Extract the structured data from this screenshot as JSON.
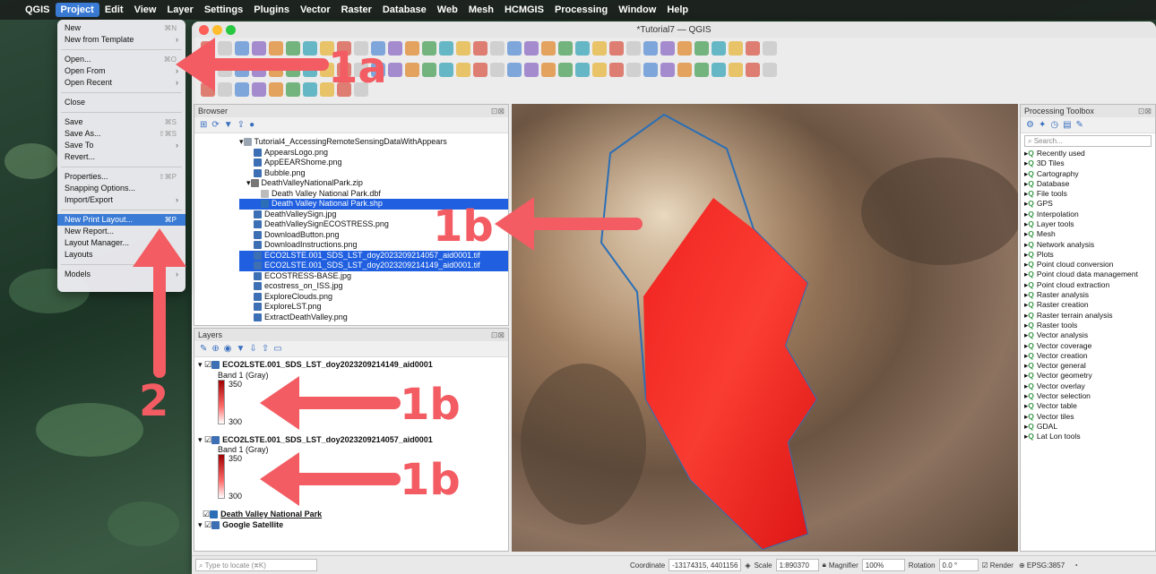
{
  "menubar": {
    "app": "QGIS",
    "items": [
      "Project",
      "Edit",
      "View",
      "Layer",
      "Settings",
      "Plugins",
      "Vector",
      "Raster",
      "Database",
      "Web",
      "Mesh",
      "HCMGIS",
      "Processing",
      "Window",
      "Help"
    ]
  },
  "window": {
    "title": "*Tutorial7 — QGIS"
  },
  "project_menu": {
    "items": [
      {
        "label": "New",
        "shortcut": "⌘N",
        "dim": false
      },
      {
        "label": "New from Template",
        "arrow": "›"
      },
      {
        "sep": true
      },
      {
        "label": "Open...",
        "shortcut": "⌘O"
      },
      {
        "label": "Open From",
        "arrow": "›"
      },
      {
        "label": "Open Recent",
        "arrow": "›"
      },
      {
        "sep": true
      },
      {
        "label": "Close"
      },
      {
        "sep": true
      },
      {
        "label": "Save",
        "shortcut": "⌘S"
      },
      {
        "label": "Save As...",
        "shortcut": "⇧⌘S"
      },
      {
        "label": "Save To",
        "arrow": "›"
      },
      {
        "label": "Revert..."
      },
      {
        "sep": true
      },
      {
        "label": "Properties...",
        "shortcut": "⇧⌘P"
      },
      {
        "label": "Snapping Options..."
      },
      {
        "label": "Import/Export",
        "arrow": "›"
      },
      {
        "sep": true
      },
      {
        "label": "New Print Layout...",
        "shortcut": "⌘P",
        "highlight": true
      },
      {
        "label": "New Report..."
      },
      {
        "label": "Layout Manager..."
      },
      {
        "label": "Layouts",
        "arrow": "›"
      },
      {
        "sep": true
      },
      {
        "label": "Models",
        "arrow": "›"
      }
    ]
  },
  "browser": {
    "title": "Browser",
    "items": [
      {
        "label": "Tutorial4_AccessingRemoteSensingDataWithAppears",
        "indent": 0,
        "icon": "folder"
      },
      {
        "label": "AppearsLogo.png",
        "indent": 2,
        "icon": "raster"
      },
      {
        "label": "AppEEARShome.png",
        "indent": 2,
        "icon": "raster"
      },
      {
        "label": "Bubble.png",
        "indent": 2,
        "icon": "raster"
      },
      {
        "label": "DeathValleyNationalPark.zip",
        "indent": 1,
        "icon": "zip"
      },
      {
        "label": "Death Valley National Park.dbf",
        "indent": 3,
        "icon": "table"
      },
      {
        "label": "Death Valley National Park.shp",
        "indent": 3,
        "icon": "vector",
        "sel": true
      },
      {
        "label": "DeathValleySign.jpg",
        "indent": 2,
        "icon": "raster"
      },
      {
        "label": "DeathValleySignECOSTRESS.png",
        "indent": 2,
        "icon": "raster"
      },
      {
        "label": "DownloadButton.png",
        "indent": 2,
        "icon": "raster"
      },
      {
        "label": "DownloadInstructions.png",
        "indent": 2,
        "icon": "raster"
      },
      {
        "label": "ECO2LSTE.001_SDS_LST_doy2023209214057_aid0001.tif",
        "indent": 2,
        "icon": "raster",
        "sel": true
      },
      {
        "label": "ECO2LSTE.001_SDS_LST_doy2023209214149_aid0001.tif",
        "indent": 2,
        "icon": "raster",
        "sel": true
      },
      {
        "label": "ECOSTRESS-BASE.jpg",
        "indent": 2,
        "icon": "raster"
      },
      {
        "label": "ecostress_on_ISS.jpg",
        "indent": 2,
        "icon": "raster"
      },
      {
        "label": "ExploreClouds.png",
        "indent": 2,
        "icon": "raster"
      },
      {
        "label": "ExploreLST.png",
        "indent": 2,
        "icon": "raster"
      },
      {
        "label": "ExtractDeathValley.png",
        "indent": 2,
        "icon": "raster"
      }
    ]
  },
  "layers": {
    "title": "Layers",
    "groups": [
      {
        "label": "ECO2LSTE.001_SDS_LST_doy2023209214149_aid0001",
        "band": "Band 1 (Gray)",
        "max": "350",
        "min": "300"
      },
      {
        "label": "ECO2LSTE.001_SDS_LST_doy2023209214057_aid0001",
        "band": "Band 1 (Gray)",
        "max": "350",
        "min": "300"
      }
    ],
    "vector": "Death Valley National Park",
    "basemap": "Google Satellite"
  },
  "toolbox": {
    "title": "Processing Toolbox",
    "search_placeholder": "Search...",
    "items": [
      "Recently used",
      "3D Tiles",
      "Cartography",
      "Database",
      "File tools",
      "GPS",
      "Interpolation",
      "Layer tools",
      "Mesh",
      "Network analysis",
      "Plots",
      "Point cloud conversion",
      "Point cloud data management",
      "Point cloud extraction",
      "Raster analysis",
      "Raster creation",
      "Raster terrain analysis",
      "Raster tools",
      "Vector analysis",
      "Vector coverage",
      "Vector creation",
      "Vector general",
      "Vector geometry",
      "Vector overlay",
      "Vector selection",
      "Vector table",
      "Vector tiles",
      "GDAL",
      "Lat Lon tools"
    ]
  },
  "statusbar": {
    "locate_placeholder": "Type to locate (⌘K)",
    "coordinate_label": "Coordinate",
    "coordinate": "-13174315, 4401156",
    "scale_label": "Scale",
    "scale": "1:890370",
    "magnifier_label": "Magnifier",
    "magnifier": "100%",
    "rotation_label": "Rotation",
    "rotation": "0.0 °",
    "render_label": "Render",
    "crs": "EPSG:3857"
  },
  "annotations": {
    "a1": "1a",
    "b1": "1b",
    "b2": "1b",
    "b3": "1b",
    "n2": "2"
  },
  "colors": {
    "annotation": "#f25c62",
    "selection": "#1f5fe0",
    "raster": "#e81b1b",
    "boundary": "#2c6fb6"
  }
}
